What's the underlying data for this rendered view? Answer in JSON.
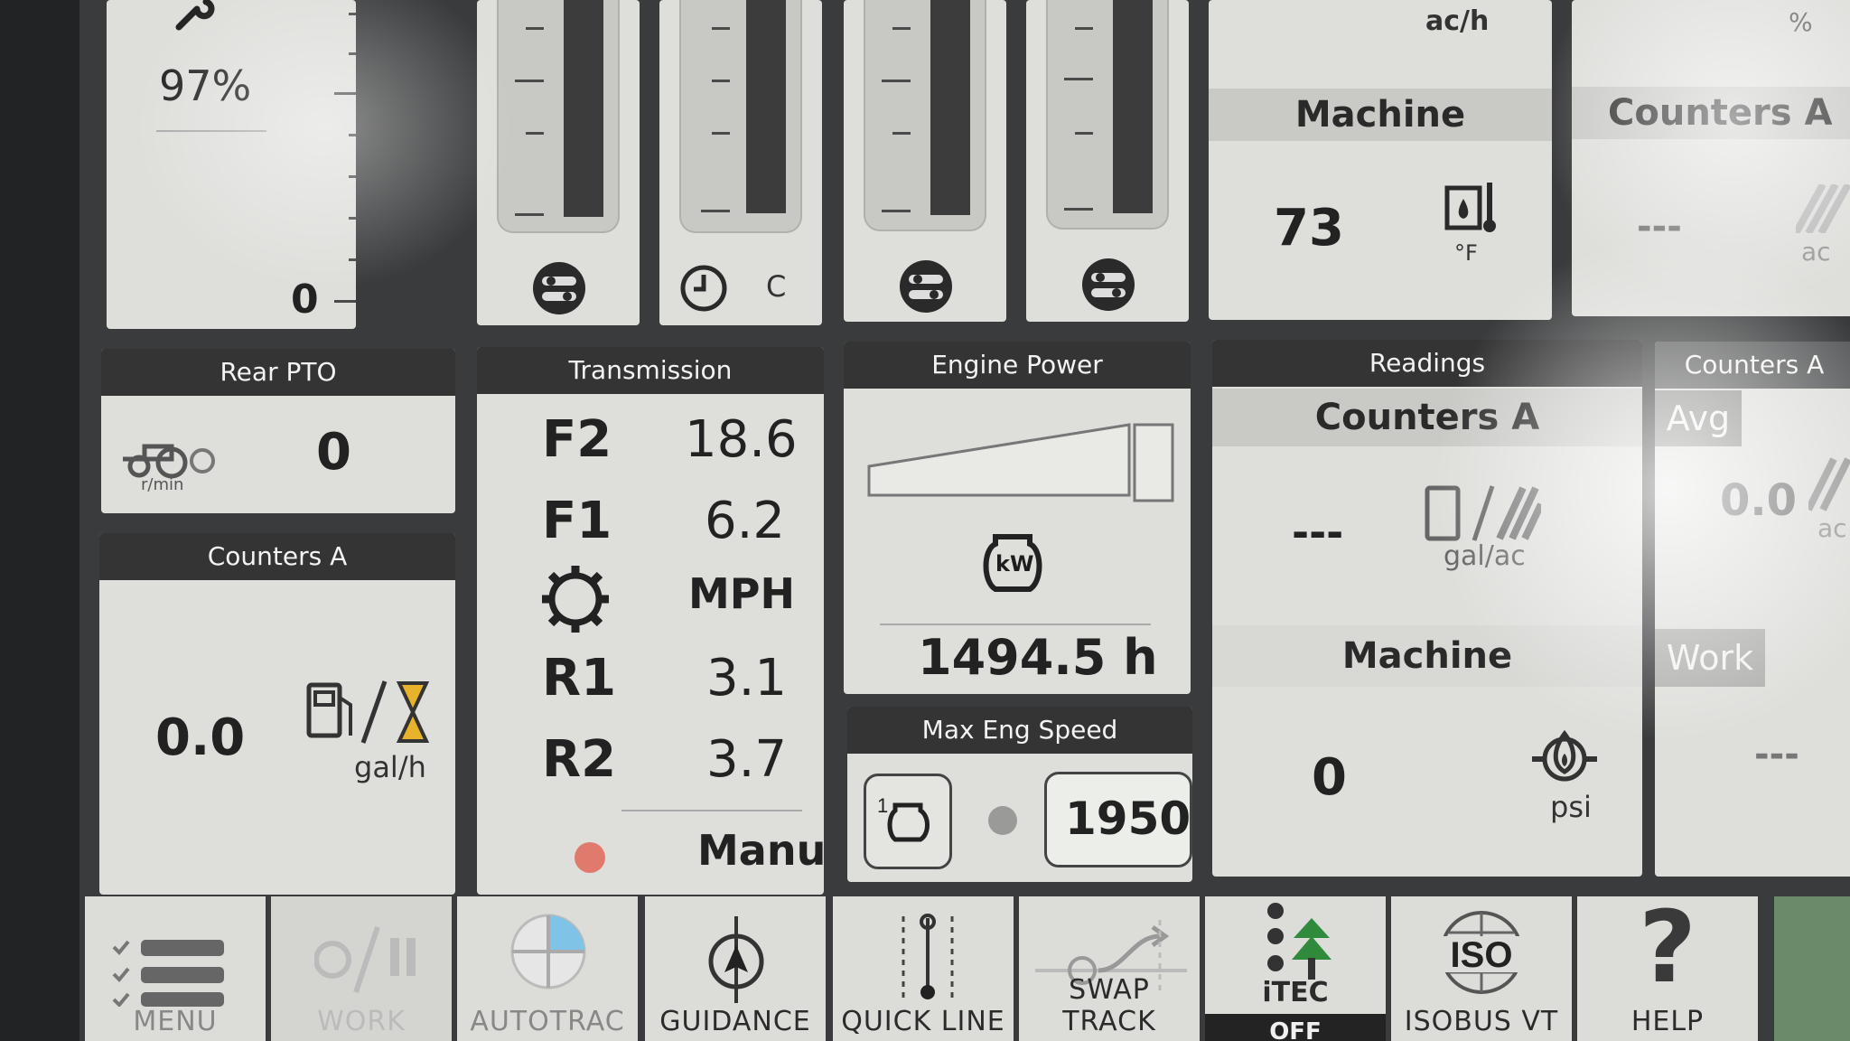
{
  "top_row": {
    "load_gauge": {
      "percent_label": "97%",
      "zero_label": "0"
    },
    "temp_gauge": {
      "unit": "C"
    },
    "rate_tile": {
      "unit": "ac/h"
    },
    "machine_temp": {
      "title": "Machine",
      "value": "73",
      "unit": "°F"
    },
    "counters_top": {
      "title": "Counters A",
      "value": "---",
      "unit": "ac",
      "top_unit": "%"
    }
  },
  "rear_pto": {
    "title": "Rear PTO",
    "value": "0",
    "unit": "r/min"
  },
  "counters_fuel": {
    "title": "Counters A",
    "value": "0.0",
    "unit": "gal/h"
  },
  "transmission": {
    "title": "Transmission",
    "rows": [
      {
        "gear": "F2",
        "value": "18.6"
      },
      {
        "gear": "F1",
        "value": "6.2"
      },
      {
        "gear": "",
        "value": "MPH"
      },
      {
        "gear": "R1",
        "value": "3.1"
      },
      {
        "gear": "R2",
        "value": "3.7"
      }
    ],
    "mode": "Manual"
  },
  "engine_power": {
    "title": "Engine Power",
    "icon_label": "kW",
    "hours": "1494.5 h"
  },
  "max_eng_speed": {
    "title": "Max Eng Speed",
    "value": "1950"
  },
  "readings": {
    "title": "Readings",
    "counters_title": "Counters A",
    "counters_value": "---",
    "counters_unit": "gal/ac",
    "machine_title": "Machine",
    "machine_value": "0",
    "machine_unit": "psi"
  },
  "counters_side": {
    "title": "Counters A",
    "avg_label": "Avg",
    "avg_value": "0.0",
    "avg_unit": "ac",
    "work_label": "Work",
    "work_value": "---"
  },
  "nav": [
    {
      "label": "MENU",
      "icon": "menu-checklist-icon"
    },
    {
      "label": "WORK",
      "icon": "work-pause-icon"
    },
    {
      "label": "AUTOTRAC",
      "icon": "autotrac-icon"
    },
    {
      "label": "GUIDANCE",
      "icon": "guidance-compass-icon"
    },
    {
      "label": "QUICK LINE",
      "icon": "quick-line-icon"
    },
    {
      "label": "SWAP TRACK",
      "icon": "swap-track-icon"
    },
    {
      "label": "iTEC",
      "sublabel": "OFF",
      "icon": "itec-tree-icon"
    },
    {
      "label": "ISOBUS VT",
      "icon": "iso-globe-icon"
    },
    {
      "label": "HELP",
      "icon": "help-question-icon"
    }
  ],
  "colors": {
    "header": "#343434",
    "tile": "#dedfdb",
    "accent_green": "#2f8a3c",
    "hourglass": "#e8b32a"
  }
}
